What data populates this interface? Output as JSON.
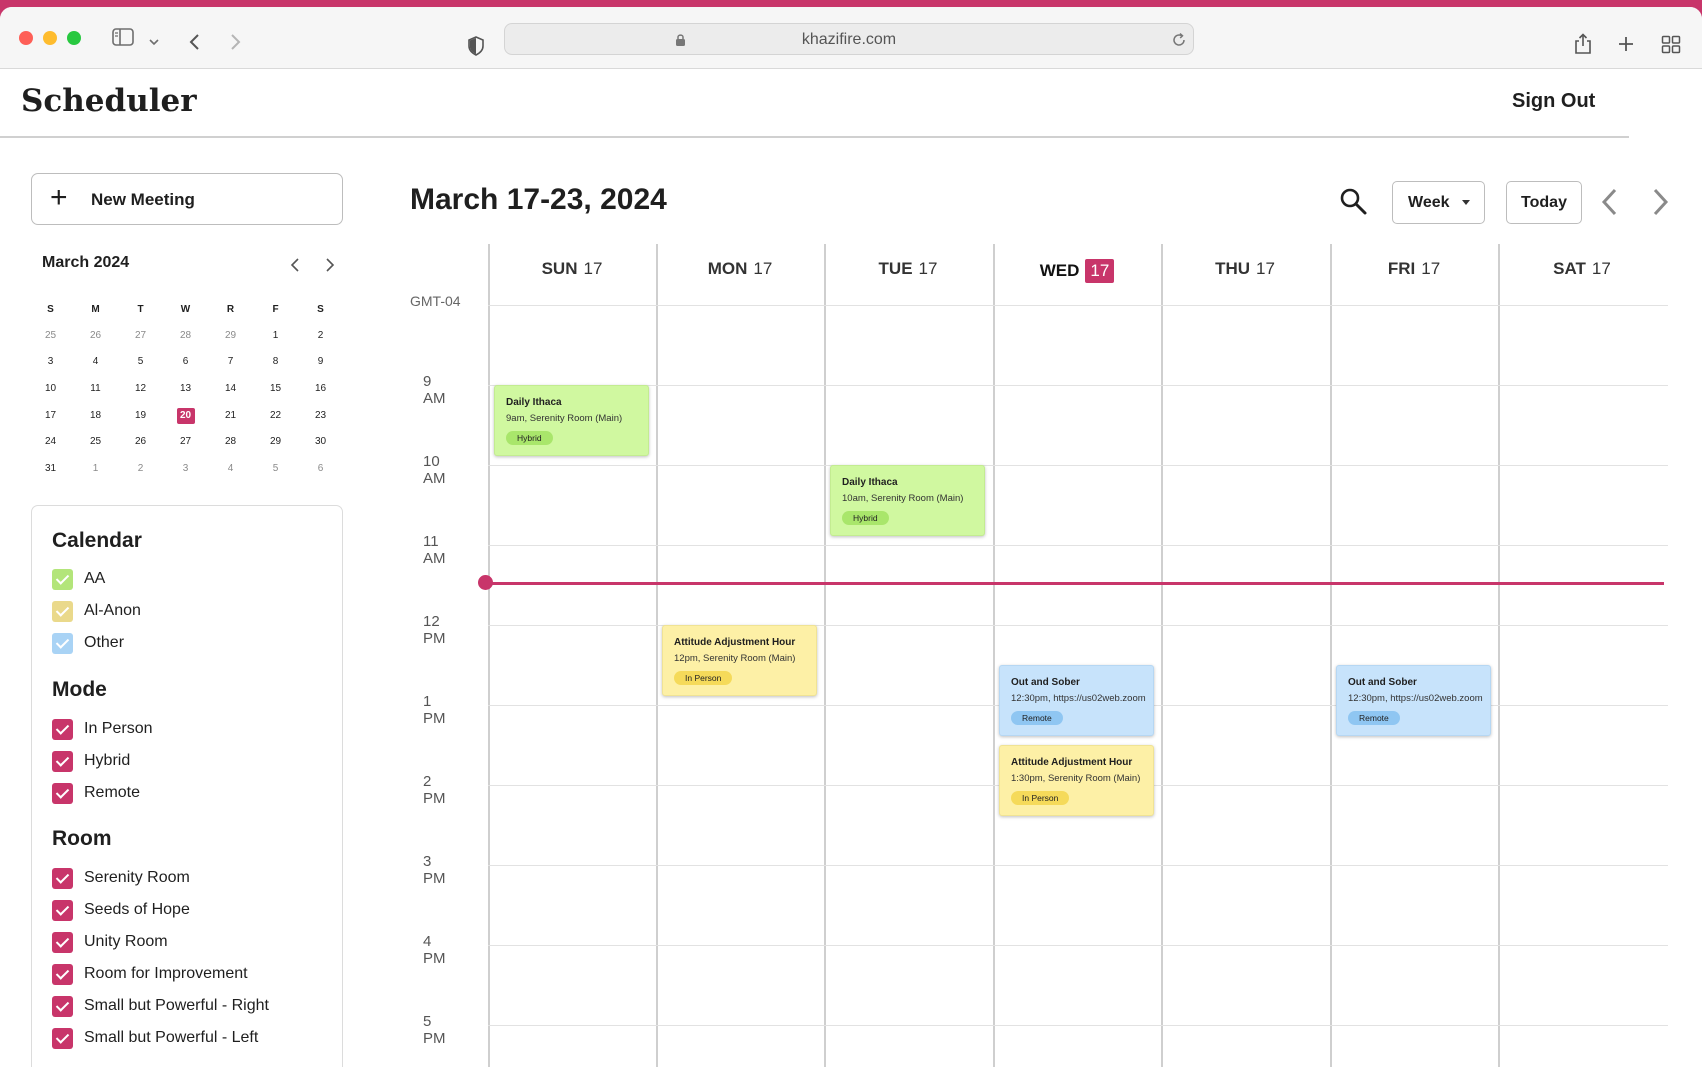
{
  "browser": {
    "url": "khazifire.com"
  },
  "header": {
    "title": "Scheduler",
    "sign_out": "Sign Out"
  },
  "sidebar": {
    "new_meeting": "New Meeting",
    "mini_calendar": {
      "month_label": "March 2024",
      "weekdays": [
        "S",
        "M",
        "T",
        "W",
        "R",
        "F",
        "S"
      ],
      "weeks": [
        [
          "25",
          "26",
          "27",
          "28",
          "29",
          "1",
          "2"
        ],
        [
          "3",
          "4",
          "5",
          "6",
          "7",
          "8",
          "9"
        ],
        [
          "10",
          "11",
          "12",
          "13",
          "14",
          "15",
          "16"
        ],
        [
          "17",
          "18",
          "19",
          "20",
          "21",
          "22",
          "23"
        ],
        [
          "24",
          "25",
          "26",
          "27",
          "28",
          "29",
          "30"
        ],
        [
          "31",
          "1",
          "2",
          "3",
          "4",
          "5",
          "6"
        ]
      ],
      "today": "20"
    },
    "filters": {
      "calendar": {
        "title": "Calendar",
        "items": [
          {
            "label": "AA",
            "color": "#b3e57a"
          },
          {
            "label": "Al-Anon",
            "color": "#ead98b"
          },
          {
            "label": "Other",
            "color": "#a9d3f5"
          }
        ]
      },
      "mode": {
        "title": "Mode",
        "items": [
          "In Person",
          "Hybrid",
          "Remote"
        ]
      },
      "room": {
        "title": "Room",
        "items": [
          "Serenity Room",
          "Seeds of Hope",
          "Unity Room",
          "Room for Improvement",
          "Small but Powerful - Right",
          "Small but Powerful - Left"
        ]
      },
      "checked_color": "#c8356a"
    }
  },
  "main": {
    "range_title": "March 17-23, 2024",
    "view_select": "Week",
    "today_button": "Today",
    "timezone": "GMT-04",
    "days": [
      {
        "name": "SUN",
        "num": "17"
      },
      {
        "name": "MON",
        "num": "17"
      },
      {
        "name": "TUE",
        "num": "17"
      },
      {
        "name": "WED",
        "num": "17",
        "current": true
      },
      {
        "name": "THU",
        "num": "17"
      },
      {
        "name": "FRI",
        "num": "17"
      },
      {
        "name": "SAT",
        "num": "17"
      }
    ],
    "times": [
      "9 AM",
      "10 AM",
      "11 AM",
      "12 PM",
      "1 PM",
      "2 PM",
      "3 PM",
      "4 PM",
      "5 PM"
    ],
    "events": [
      {
        "title": "Daily Ithaca",
        "detail": "9am, Serenity Room (Main)",
        "tag": "Hybrid",
        "color": "green",
        "day": 0,
        "start": "9:00"
      },
      {
        "title": "Daily Ithaca",
        "detail": "10am, Serenity Room (Main)",
        "tag": "Hybrid",
        "color": "green",
        "day": 2,
        "start": "10:00"
      },
      {
        "title": "Attitude Adjustment Hour",
        "detail": "12pm, Serenity Room (Main)",
        "tag": "In Person",
        "color": "yellow",
        "day": 1,
        "start": "12:00"
      },
      {
        "title": "Out and Sober",
        "detail": "12:30pm, https://us02web.zoom",
        "tag": "Remote",
        "color": "blue",
        "day": 3,
        "start": "12:30"
      },
      {
        "title": "Attitude Adjustment Hour",
        "detail": "1:30pm, Serenity Room (Main)",
        "tag": "In Person",
        "color": "yellow",
        "day": 3,
        "start": "13:30"
      },
      {
        "title": "Out and Sober",
        "detail": "12:30pm, https://us02web.zoom",
        "tag": "Remote",
        "color": "blue",
        "day": 5,
        "start": "12:30"
      }
    ],
    "accent": "#c8356a"
  }
}
